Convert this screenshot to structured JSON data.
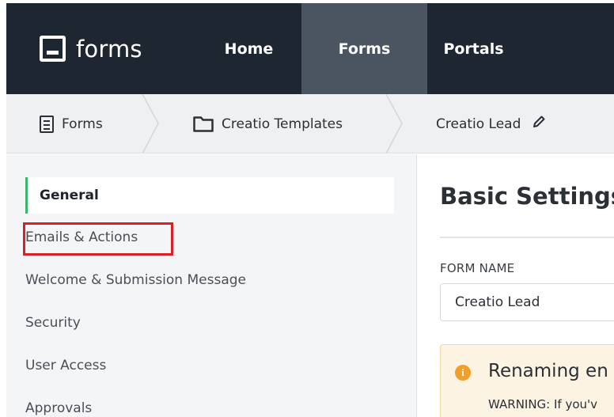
{
  "brand": {
    "name": "forms"
  },
  "topnav": {
    "items": [
      {
        "label": "Home"
      },
      {
        "label": "Forms",
        "active": true
      },
      {
        "label": "Portals"
      }
    ]
  },
  "breadcrumb": {
    "items": [
      {
        "label": "Forms",
        "icon": "document-icon"
      },
      {
        "label": "Creatio Templates",
        "icon": "folder-icon"
      },
      {
        "label": "Creatio Lead",
        "icon": "pencil-icon"
      }
    ]
  },
  "sidebar": {
    "items": [
      {
        "label": "General",
        "active": true
      },
      {
        "label": "Emails & Actions",
        "highlighted": true
      },
      {
        "label": "Welcome & Submission Message"
      },
      {
        "label": "Security"
      },
      {
        "label": "User Access"
      },
      {
        "label": "Approvals"
      }
    ]
  },
  "main": {
    "title": "Basic Settings",
    "form_name_label": "FORM NAME",
    "form_name_value": "Creatio Lead",
    "warning": {
      "title": "Renaming en",
      "body": "WARNING: If you'v"
    }
  },
  "colors": {
    "nav_bg": "#1e2731",
    "nav_active": "#4a5561",
    "accent_green": "#3bb56b",
    "highlight_red": "#d92027",
    "warning_icon": "#f0a02a"
  }
}
